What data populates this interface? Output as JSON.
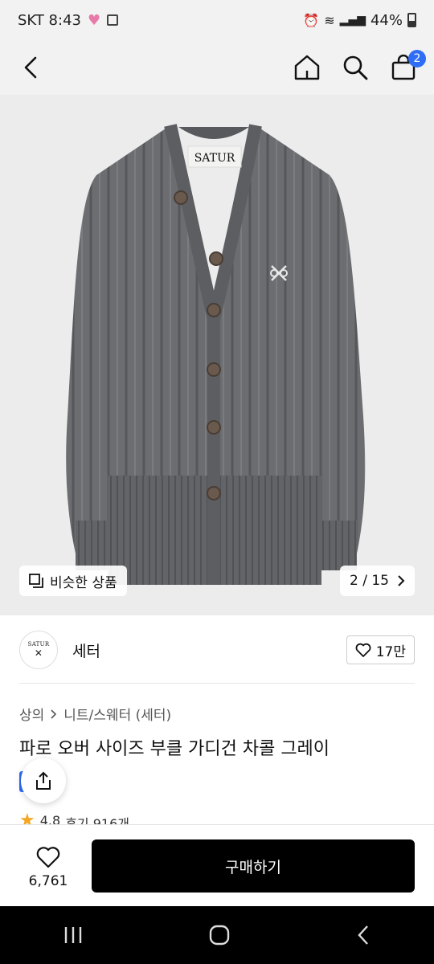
{
  "status_bar": {
    "carrier_time": "SKT 8:43",
    "battery": "44%"
  },
  "nav": {
    "cart_count": "2"
  },
  "product_image": {
    "label": "SATUR",
    "similar_label": "비슷한 상품",
    "page_counter": "2 / 15"
  },
  "brand": {
    "logo_text": "SATUR",
    "name": "세터",
    "like_count": "17만"
  },
  "breadcrumb": {
    "category": "상의",
    "subcategory": "니트/스웨터 (세터)"
  },
  "product": {
    "title": "파로 오버 사이즈 부클 가디건 차콜 그레이",
    "rating": "4.8",
    "reviews": "후기 916개"
  },
  "bottom": {
    "wish_count": "6,761",
    "buy_label": "구매하기"
  },
  "colors": {
    "accent_blue": "#2f6df6",
    "cardigan_gray": "#6b6d71",
    "button_black": "#000000"
  }
}
